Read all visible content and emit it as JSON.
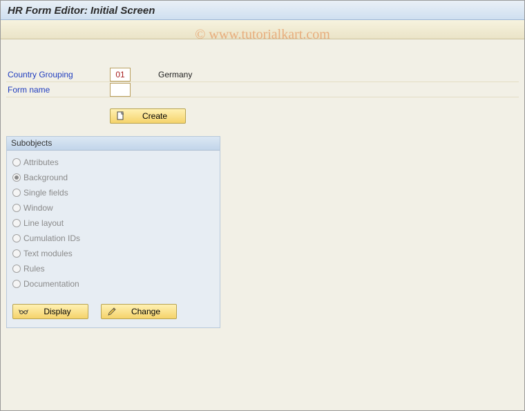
{
  "title": "HR Form Editor: Initial Screen",
  "watermark": "© www.tutorialkart.com",
  "form": {
    "country_grouping_label": "Country Grouping",
    "country_grouping_value": "01",
    "country_grouping_text": "Germany",
    "form_name_label": "Form name",
    "form_name_value": ""
  },
  "buttons": {
    "create": "Create",
    "display": "Display",
    "change": "Change"
  },
  "subobjects": {
    "header": "Subobjects",
    "items": [
      {
        "label": "Attributes",
        "selected": false
      },
      {
        "label": "Background",
        "selected": true
      },
      {
        "label": "Single fields",
        "selected": false
      },
      {
        "label": "Window",
        "selected": false
      },
      {
        "label": "Line layout",
        "selected": false
      },
      {
        "label": "Cumulation IDs",
        "selected": false
      },
      {
        "label": "Text modules",
        "selected": false
      },
      {
        "label": "Rules",
        "selected": false
      },
      {
        "label": "Documentation",
        "selected": false
      }
    ]
  }
}
